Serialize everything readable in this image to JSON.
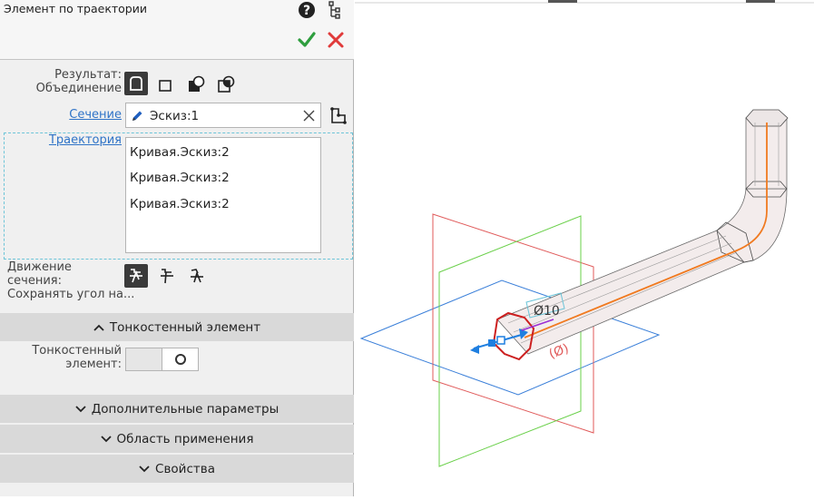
{
  "header": {
    "title": "Элемент по траектории",
    "help_icon": "help-icon",
    "tree_icon": "tree-icon",
    "ok_icon": "checkmark-icon",
    "cancel_icon": "close-icon",
    "ok_color": "#2e9e3e",
    "cancel_color": "#e03a3a"
  },
  "result": {
    "label_line1": "Результат:",
    "label_line2": "Объединение",
    "options": [
      "union-icon",
      "new-body-icon",
      "subtract-icon",
      "intersect-icon"
    ],
    "selected": "union-icon"
  },
  "section": {
    "label": "Сечение",
    "value": "Эскиз:1",
    "edit_icon": "pencil-icon",
    "clear_icon": "clear-icon",
    "pick_icon": "pick-contour-icon"
  },
  "trajectory": {
    "label": "Траектория",
    "items": [
      "Кривая.Эскиз:2",
      "Кривая.Эскиз:2",
      "Кривая.Эскиз:2"
    ]
  },
  "motion": {
    "label_line1": "Движение сечения:",
    "label_line2": "Сохранять угол на...",
    "options": [
      "keep-angle-icon",
      "parallel-icon",
      "orthogonal-icon"
    ],
    "selected": "keep-angle-icon"
  },
  "thin_wall": {
    "group_label": "Тонкостенный элемент",
    "label_line1": "Тонкостенный",
    "label_line2": "элемент:",
    "toggle_on": false
  },
  "groups": {
    "additional": "Дополнительные параметры",
    "scope": "Область применения",
    "properties": "Свойства"
  },
  "viewport": {
    "dimension_diameter": "Ø10",
    "dimension_angle": "(Ø)",
    "colors": {
      "plane_front": "#e05a5a",
      "plane_side": "#6ad04a",
      "plane_top": "#3a7fd9",
      "path": "#f07a20",
      "section": "#cc1f1f",
      "manipulator": "#1f7fe0",
      "body": "#6a6a6a"
    }
  }
}
